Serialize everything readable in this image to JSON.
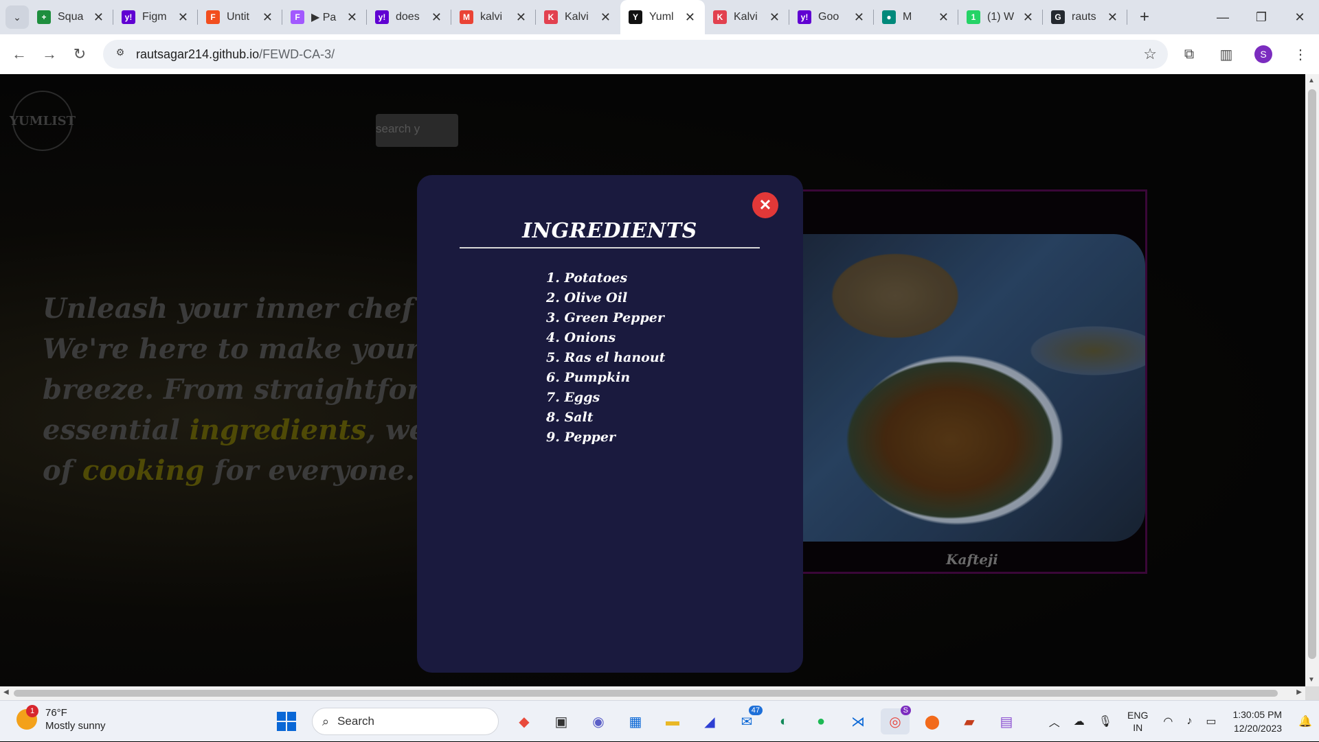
{
  "browser": {
    "tabs": [
      {
        "title": "Squa",
        "icon": "sheets-icon",
        "color": "#1e8e3e",
        "glyph": "+"
      },
      {
        "title": "Figm",
        "icon": "yahoo-icon",
        "color": "#6001d2",
        "glyph": "y!"
      },
      {
        "title": "Untit",
        "icon": "figma-icon",
        "color": "#f24e1e",
        "glyph": "F"
      },
      {
        "title": "▶ Pa",
        "icon": "figma-icon",
        "color": "#a259ff",
        "glyph": "F"
      },
      {
        "title": "does",
        "icon": "yahoo-icon",
        "color": "#6001d2",
        "glyph": "y!"
      },
      {
        "title": "kalvi",
        "icon": "gmail-icon",
        "color": "#ea4335",
        "glyph": "M"
      },
      {
        "title": "Kalvi",
        "icon": "kalvium-icon",
        "color": "#e2414f",
        "glyph": "K"
      },
      {
        "title": "Yuml",
        "icon": "yumlist-icon",
        "color": "#111111",
        "glyph": "Y"
      },
      {
        "title": "Kalvi",
        "icon": "kalvium-icon",
        "color": "#e2414f",
        "glyph": "K"
      },
      {
        "title": "Goo",
        "icon": "yahoo-icon",
        "color": "#6001d2",
        "glyph": "y!"
      },
      {
        "title": "M",
        "icon": "meet-icon",
        "color": "#00897b",
        "glyph": "●"
      },
      {
        "title": "(1) W",
        "icon": "whatsapp-icon",
        "color": "#25d366",
        "glyph": "1"
      },
      {
        "title": "rauts",
        "icon": "github-icon",
        "color": "#24292f",
        "glyph": "G"
      }
    ],
    "active_tab_index": 7,
    "url_host": "rautsagar214.github.io",
    "url_path": "/FEWD-CA-3/",
    "profile_initial": "S"
  },
  "page": {
    "logo_text": "YUMLIST",
    "search_placeholder": "search y",
    "hero_parts": [
      {
        "text": "Unleash your inner chef wit",
        "highlight": false
      },
      {
        "text": "We're here to make your cul",
        "highlight": false
      },
      {
        "text": "breeze. From straightforwa",
        "highlight": false
      },
      {
        "text": "essential ",
        "highlight": false
      },
      {
        "text": "ingredients",
        "highlight": true
      },
      {
        "text": ", we've",
        "highlight": false
      },
      {
        "text": "of ",
        "highlight": false
      },
      {
        "text": "cooking",
        "highlight": true
      },
      {
        "text": " for everyone.",
        "highlight": false
      }
    ],
    "card_title": "Kafteji"
  },
  "modal": {
    "title": "INGREDIENTS",
    "close_glyph": "✕",
    "ingredients": [
      "1. Potatoes",
      "2. Olive Oil",
      "3. Green Pepper",
      "4. Onions",
      "5. Ras el hanout",
      "6. Pumpkin",
      "7. Eggs",
      "8. Salt",
      "9. Pepper"
    ]
  },
  "taskbar": {
    "weather_temp": "76°F",
    "weather_desc": "Mostly sunny",
    "weather_badge": "1",
    "search_label": "Search",
    "mail_badge": "47",
    "chrome_badge": "S",
    "lang_line1": "ENG",
    "lang_line2": "IN",
    "time": "1:30:05 PM",
    "date": "12/20/2023"
  },
  "colors": {
    "modal_bg": "#1a1a3e",
    "close_button": "#e23838",
    "highlight_text": "#4f4a06",
    "card_border": "#3a0738"
  }
}
